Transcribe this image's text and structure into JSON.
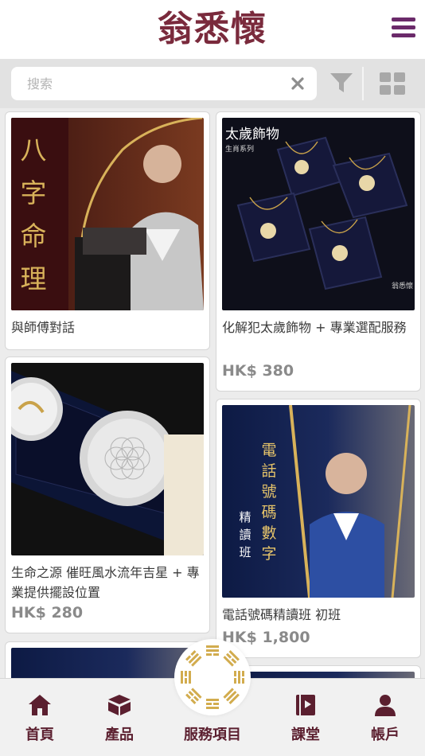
{
  "header": {
    "logo_text": "翁悉懷",
    "menu_icon": "hamburger-menu-icon"
  },
  "search": {
    "placeholder": "搜索",
    "value": "",
    "clear_icon": "close-icon",
    "filter_icon": "filter-icon",
    "view_icon": "grid-view-icon"
  },
  "products": [
    {
      "title": "與師傅對話",
      "price": "",
      "image_text": [
        "八",
        "字",
        "命",
        "理"
      ]
    },
    {
      "title": "化解犯太歲飾物 + 專業選配服務",
      "price": "HK$ 380",
      "image_text": [
        "太歲飾物",
        "生肖系列",
        "翁悉懷"
      ]
    },
    {
      "title": "生命之源 催旺風水流年吉星 + 專業提供擺設位置",
      "price": "HK$ 280",
      "image_text": []
    },
    {
      "title": "電話號碼精讀班 初班",
      "price": "HK$ 1,800",
      "image_text": [
        "電",
        "話",
        "號",
        "碼",
        "數",
        "字",
        "精",
        "讀",
        "班"
      ]
    }
  ],
  "bottom_nav": {
    "items": [
      {
        "label": "首頁",
        "icon": "home-icon"
      },
      {
        "label": "產品",
        "icon": "box-icon"
      },
      {
        "label": "服務項目",
        "icon": "bagua-icon"
      },
      {
        "label": "課堂",
        "icon": "book-icon"
      },
      {
        "label": "帳戶",
        "icon": "user-icon"
      }
    ]
  },
  "colors": {
    "brand": "#7a2a3c",
    "menu": "#6b2a6a",
    "nav_label": "#5b1f2f",
    "price": "#8a8a8a",
    "gold": "#c9a24a"
  }
}
